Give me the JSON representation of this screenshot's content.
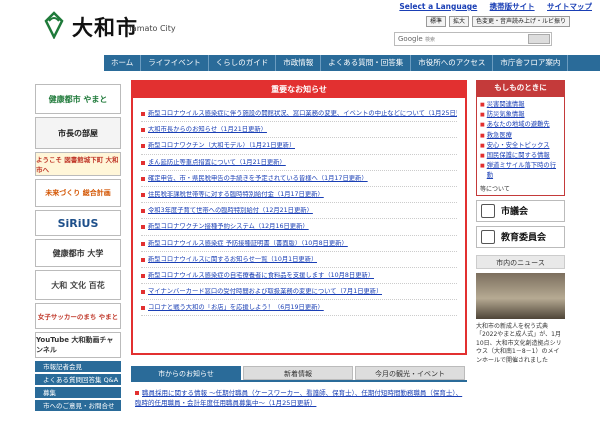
{
  "header": {
    "logo_text": "大和市",
    "logo_en": "Yamato City",
    "links": [
      "Select a Language",
      "携帯版サイト",
      "サイトマップ"
    ],
    "size_buttons": [
      "標準",
      "拡大",
      "色変更・音声読み上げ・ルビ振り"
    ],
    "search_brand": "Google",
    "search_placeholder": "検索"
  },
  "nav": [
    "ホーム",
    "ライフイベント",
    "くらしのガイド",
    "市政情報",
    "よくある質問・回答集",
    "市役所へのアクセス",
    "市庁舎フロア案内"
  ],
  "left": {
    "banners": [
      {
        "text": "健康都市 やまと"
      },
      {
        "text": "市長の部屋"
      },
      {
        "text": "ようこそ 図書館城下町 大和市へ"
      },
      {
        "text": "未来づくり 総合計画"
      },
      {
        "text": "SiRiUS"
      },
      {
        "text": "健康都市 大学"
      },
      {
        "text": "大和 文化 百花"
      },
      {
        "text": "女子サッカーのまち やまと"
      },
      {
        "text": "YouTube 大和動画チャンネル"
      }
    ],
    "menu": [
      "市報記者会見",
      "よくある質問回答集 Q&A",
      "募集",
      "市へのご意見・お問合せ"
    ]
  },
  "notices": {
    "title": "重要なお知らせ",
    "items": [
      "新型コロナウイルス感染症に伴う施設の開館状況、窓口業務の変更、イベントの中止などについて（1月25日更新）",
      "大和市長からのお知らせ（1月21日更新）",
      "新型コロナワクチン（大和モデル）（1月21日更新）",
      "まん延防止等重点措置について（1月21日更新）",
      "確定申告、市・県民税申告の手続きを予定されている皆様へ（1月17日更新）",
      "住民税非課税世帯等に対する臨時特別給付金（1月17日更新）",
      "令和3年度子育て世帯への臨時特別給付（12月21日更新）",
      "新型コロナワクチン接種予約システム（12月16日更新）",
      "新型コロナウイルス感染症 予防接種証明書（書面版）（10月8日更新）",
      "新型コロナウイルスに関するお知らせ一覧（10月1日更新）",
      "新型コロナウイルス感染症の自宅療養者に食料品を支援します（10月8日更新）",
      "マイナンバーカード窓口の受付時間および取扱業務の変更について（7月1日更新）",
      "コロナと戦う大和の「お店」を応援しよう！（6月19日更新）"
    ]
  },
  "tabs": [
    "市からのお知らせ",
    "新着情報",
    "今月の観光・イベント"
  ],
  "tab_content": "職員採用に関する情報 ～任期付職員（ケースワーカー、看護師、保育士）、任期付短時間勤務職員（保育士）、臨時的任用職員・会計年度任用職員募集中～（1月25日更新）",
  "right": {
    "emergency_title": "もしものときに",
    "emergency_items": [
      "災害関連情報",
      "防災気象情報",
      "あなたの地域の避難先",
      "救急医療",
      "安心・安全トピックス",
      "国民保護に関する情報",
      "弾道ミサイル落下時の行動"
    ],
    "emergency_footer": "等について",
    "buttons": [
      "市議会",
      "教育委員会"
    ],
    "news_title": "市内のニュース",
    "news_text": "大和市の新成人を祝う式典「2022やまと成人式」が、1月10日、大和市文化創造拠点シリウス（大和南1－8－1）のメインホールで開催されました"
  },
  "colors": {
    "nav_blue": "#2a6b99",
    "notice_red": "#e23030",
    "link_blue": "#1a3fb5"
  }
}
